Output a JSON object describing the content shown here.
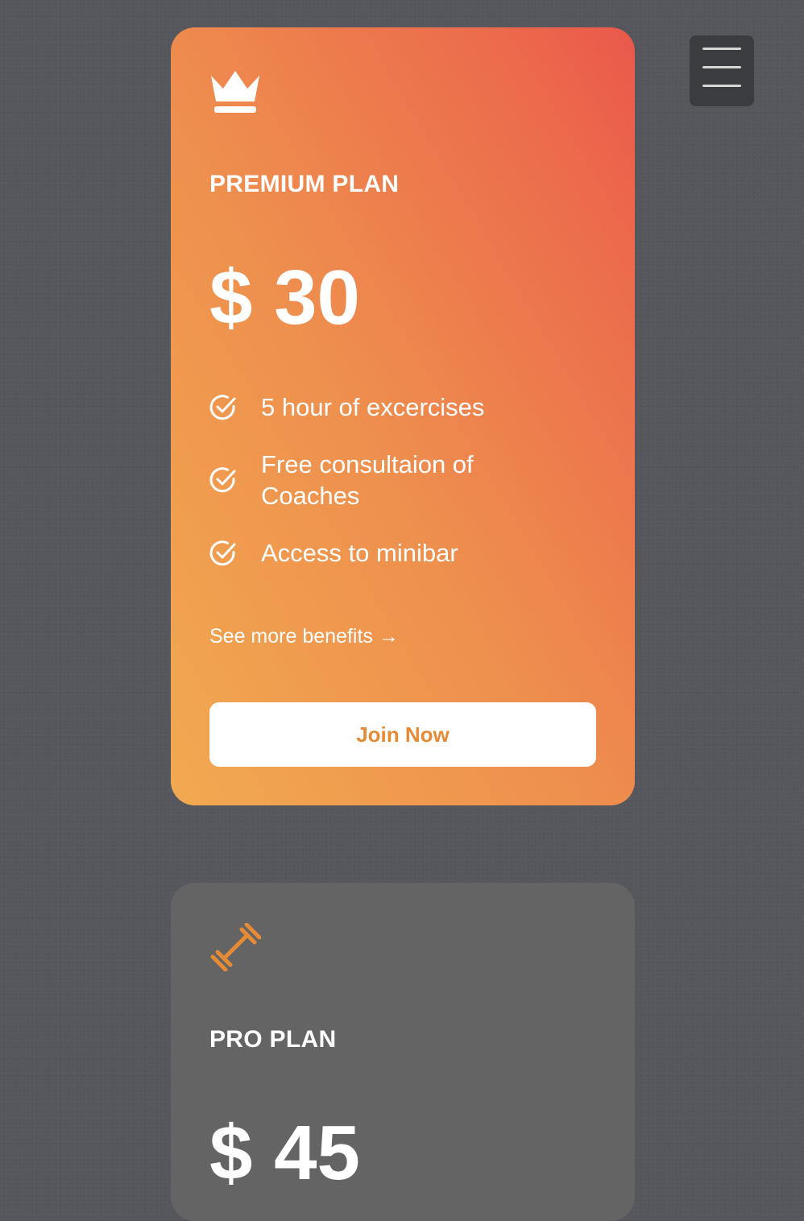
{
  "menu": {
    "icon": "hamburger-menu-icon"
  },
  "premium_plan": {
    "icon": "crown-icon",
    "name": "PREMIUM PLAN",
    "price": "$ 30",
    "features": [
      {
        "icon": "check-circle-icon",
        "label": "5 hour of excercises"
      },
      {
        "icon": "check-circle-icon",
        "label": "Free consultaion of Coaches"
      },
      {
        "icon": "check-circle-icon",
        "label": "Access to minibar"
      }
    ],
    "see_more_label": "See more benefits →",
    "cta_label": "Join Now"
  },
  "pro_plan": {
    "icon": "dumbbell-icon",
    "name": "PRO PLAN",
    "price": "$ 45"
  },
  "colors": {
    "background": "#55575c",
    "accent_orange": "#e58a35",
    "premium_gradient_start": "#f2a950",
    "premium_gradient_end": "#ea584b",
    "pro_card": "#646464"
  }
}
